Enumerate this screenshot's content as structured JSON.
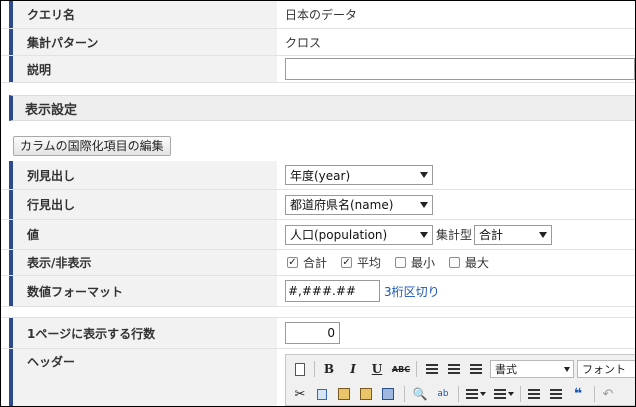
{
  "query_name": {
    "label": "クエリ名",
    "value": "日本のデータ"
  },
  "aggregation_pattern": {
    "label": "集計パターン",
    "value": "クロス"
  },
  "description": {
    "label": "説明",
    "value": ""
  },
  "display_settings": {
    "title": "表示設定",
    "i18n_button": "カラムの国際化項目の編集",
    "column_header": {
      "label": "列見出し",
      "selected": "年度(year)"
    },
    "row_header": {
      "label": "行見出し",
      "selected": "都道府県名(name)"
    },
    "value": {
      "label": "値",
      "selected": "人口(population)",
      "agg_type_label": "集計型",
      "agg_type_selected": "合計"
    },
    "show_hide": {
      "label": "表示/非表示",
      "options": [
        {
          "label": "合計",
          "checked": true
        },
        {
          "label": "平均",
          "checked": true
        },
        {
          "label": "最小",
          "checked": false
        },
        {
          "label": "最大",
          "checked": false
        }
      ]
    },
    "number_format": {
      "label": "数値フォーマット",
      "value": "#,###.##",
      "link": "3桁区切り"
    },
    "rows_per_page": {
      "label": "1ページに表示する行数",
      "value": "0"
    },
    "header": {
      "label": "ヘッダー",
      "toolbar": {
        "bold": "B",
        "italic": "I",
        "underline": "U",
        "strike": "ABC",
        "format_select": "書式",
        "font_select": "フォント",
        "quote": "❝"
      }
    }
  },
  "colors": {
    "accent": "#2d4a8a",
    "link": "#1a56b8"
  }
}
